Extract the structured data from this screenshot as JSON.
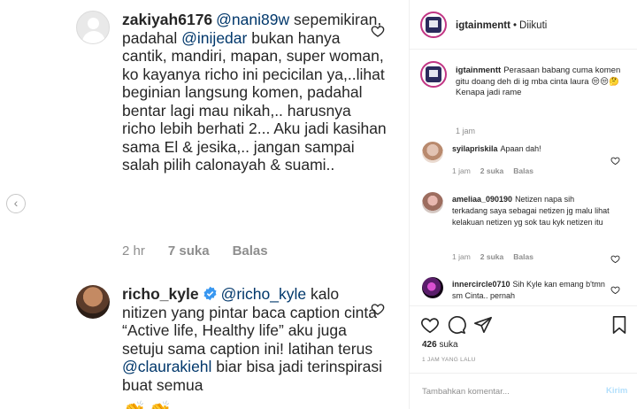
{
  "zoom": {
    "comment1": {
      "username": "zakiyah6176",
      "segments": [
        {
          "t": "@nani89w",
          "m": true
        },
        {
          "t": " sepemikiran, padahal ",
          "m": false
        },
        {
          "t": "@inijedar",
          "m": true
        },
        {
          "t": " bukan hanya cantik, mandiri, mapan, super woman, ko kayanya richo ini pecicilan ya,..lihat beginian langsung komen, padahal bentar lagi mau nikah,.. harusnya richo lebih berhati 2... Aku jadi kasihan sama El & jesika,.. jangan sampai salah pilih calonayah & suami..",
          "m": false
        }
      ],
      "time": "2 hr",
      "likes": "7 suka",
      "reply": "Balas"
    },
    "comment2": {
      "username": "richo_kyle",
      "segments": [
        {
          "t": "@richo_kyle",
          "m": true
        },
        {
          "t": " kalo nitizen yang pintar baca caption cinta “Active life, Healthy life” aku juga setuju sama caption ini! latihan terus ",
          "m": false
        },
        {
          "t": "@claurakiehl",
          "m": true
        },
        {
          "t": " biar bisa jadi terinspirasi buat semua",
          "m": false
        }
      ],
      "emoji": "👏👏"
    }
  },
  "post": {
    "account": "igtainmentt",
    "separator": "•",
    "follow_status": "Diikuti",
    "caption_user": "igtainmentt",
    "caption": "Perasaan babang cuma komen gitu doang deh di ig mba cinta laura 😒😒🤔",
    "caption_line2": "Kenapa jadi rame",
    "caption_time": "1 jam",
    "comments": [
      {
        "username": "syilapriskila",
        "text": "Apaan dah!",
        "time": "1 jam",
        "likes": "2 suka",
        "reply": "Balas"
      },
      {
        "username": "ameliaa_090190",
        "text": "Netizen napa sih terkadang saya sebagai netizen jg malu lihat kelakuan netizen yg sok tau kyk netizen itu",
        "time": "1 jam",
        "likes": "2 suka",
        "reply": "Balas"
      },
      {
        "username": "innercircle0710",
        "text": "Sih Kyle kan emang b'tmn sm Cinta.. pernah"
      }
    ],
    "likes_count": "426",
    "likes_label": "suka",
    "time_ago": "1 JAM YANG LALU",
    "add_comment_placeholder": "Tambahkan komentar...",
    "post_button": "Kirim"
  }
}
